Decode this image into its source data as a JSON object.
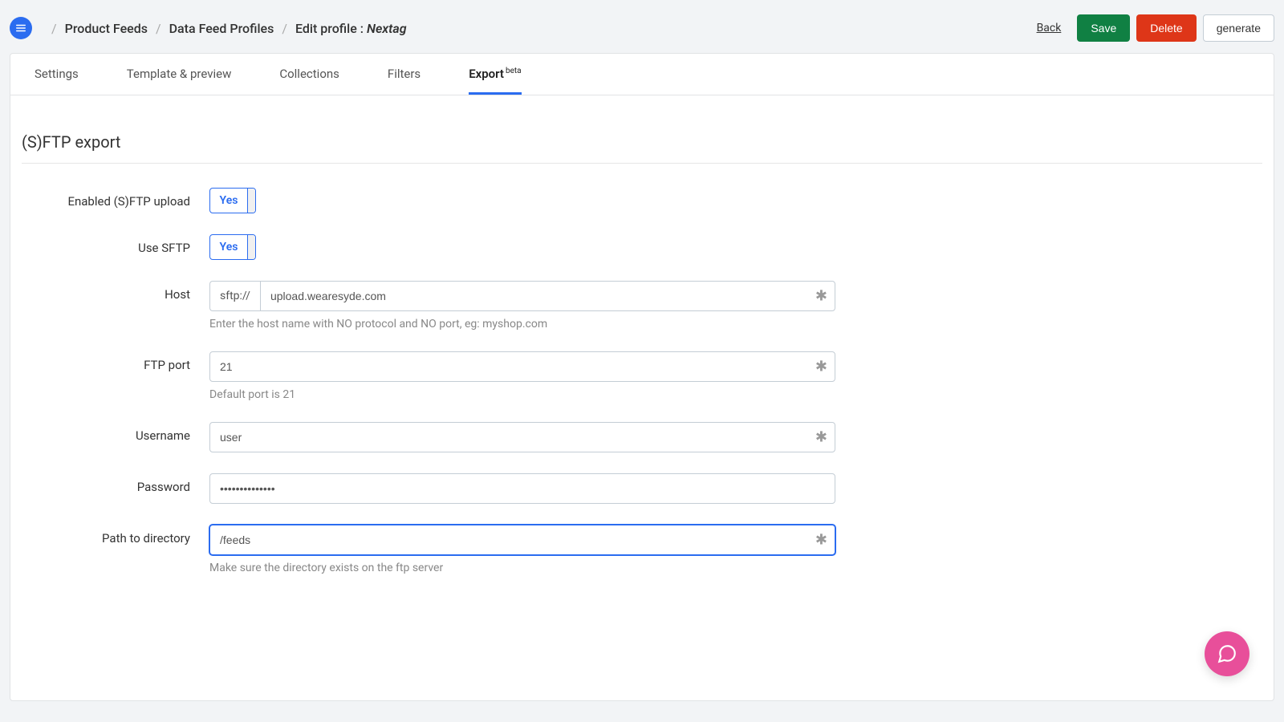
{
  "breadcrumb": {
    "level1": "Product Feeds",
    "level2": "Data Feed Profiles",
    "level3_prefix": "Edit profile : ",
    "level3_name": "Nextag"
  },
  "header": {
    "back": "Back",
    "save": "Save",
    "delete": "Delete",
    "generate": "generate"
  },
  "tabs": {
    "settings": "Settings",
    "template": "Template & preview",
    "collections": "Collections",
    "filters": "Filters",
    "export": "Export",
    "export_badge": "beta"
  },
  "section": {
    "title": "(S)FTP export"
  },
  "form": {
    "enabled_label": "Enabled (S)FTP upload",
    "enabled_value": "Yes",
    "use_sftp_label": "Use SFTP",
    "use_sftp_value": "Yes",
    "host_label": "Host",
    "host_prefix": "sftp://",
    "host_value": "upload.wearesyde.com",
    "host_help": "Enter the host name with NO protocol and NO port, eg: myshop.com",
    "port_label": "FTP port",
    "port_value": "21",
    "port_help": "Default port is 21",
    "username_label": "Username",
    "username_value": "user",
    "password_label": "Password",
    "password_value": "••••••••••••••",
    "path_label": "Path to directory",
    "path_value": "/feeds",
    "path_help": "Make sure the directory exists on the ftp server"
  }
}
